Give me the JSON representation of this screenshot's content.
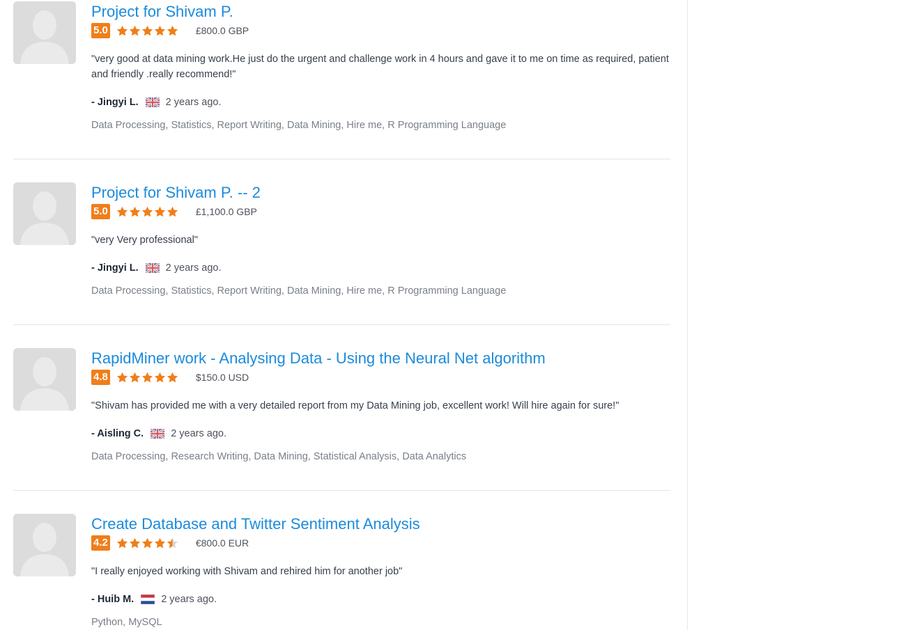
{
  "reviews": [
    {
      "title": "Project for Shivam P.",
      "score": "5.0",
      "stars": 5,
      "amount": "£800.0 GBP",
      "quote": "\"very good at data mining work.He just do the urgent and challenge work in 4 hours and gave it to me on time as required, patient and friendly .really recommend!\"",
      "reviewer": "- Jingyi L.",
      "flag": "uk-flag-icon",
      "time": "2 years ago.",
      "skills": "Data Processing, Statistics, Report Writing, Data Mining, Hire me, R Programming Language"
    },
    {
      "title": "Project for Shivam P. -- 2",
      "score": "5.0",
      "stars": 5,
      "amount": "£1,100.0 GBP",
      "quote": "\"very Very professional\"",
      "reviewer": "- Jingyi L.",
      "flag": "uk-flag-icon",
      "time": "2 years ago.",
      "skills": "Data Processing, Statistics, Report Writing, Data Mining, Hire me, R Programming Language"
    },
    {
      "title": "RapidMiner work - Analysing Data - Using the Neural Net algorithm",
      "score": "4.8",
      "stars": 5,
      "amount": "$150.0 USD",
      "quote": "\"Shivam has provided me with a very detailed report from my Data Mining job, excellent work! Will hire again for sure!\"",
      "reviewer": "- Aisling C.",
      "flag": "uk-flag-icon",
      "time": "2 years ago.",
      "skills": "Data Processing, Research Writing, Data Mining, Statistical Analysis, Data Analytics"
    },
    {
      "title": "Create Database and Twitter Sentiment Analysis",
      "score": "4.2",
      "stars": 4.5,
      "amount": "€800.0 EUR",
      "quote": "\"I really enjoyed working with Shivam and rehired him for another job\"",
      "reviewer": "- Huib M.",
      "flag": "netherlands-flag-icon",
      "time": "2 years ago.",
      "skills": "Python, MySQL"
    }
  ],
  "colors": {
    "link": "#1b8bdb",
    "score_badge": "#f07e19",
    "star": "#f07e19"
  }
}
